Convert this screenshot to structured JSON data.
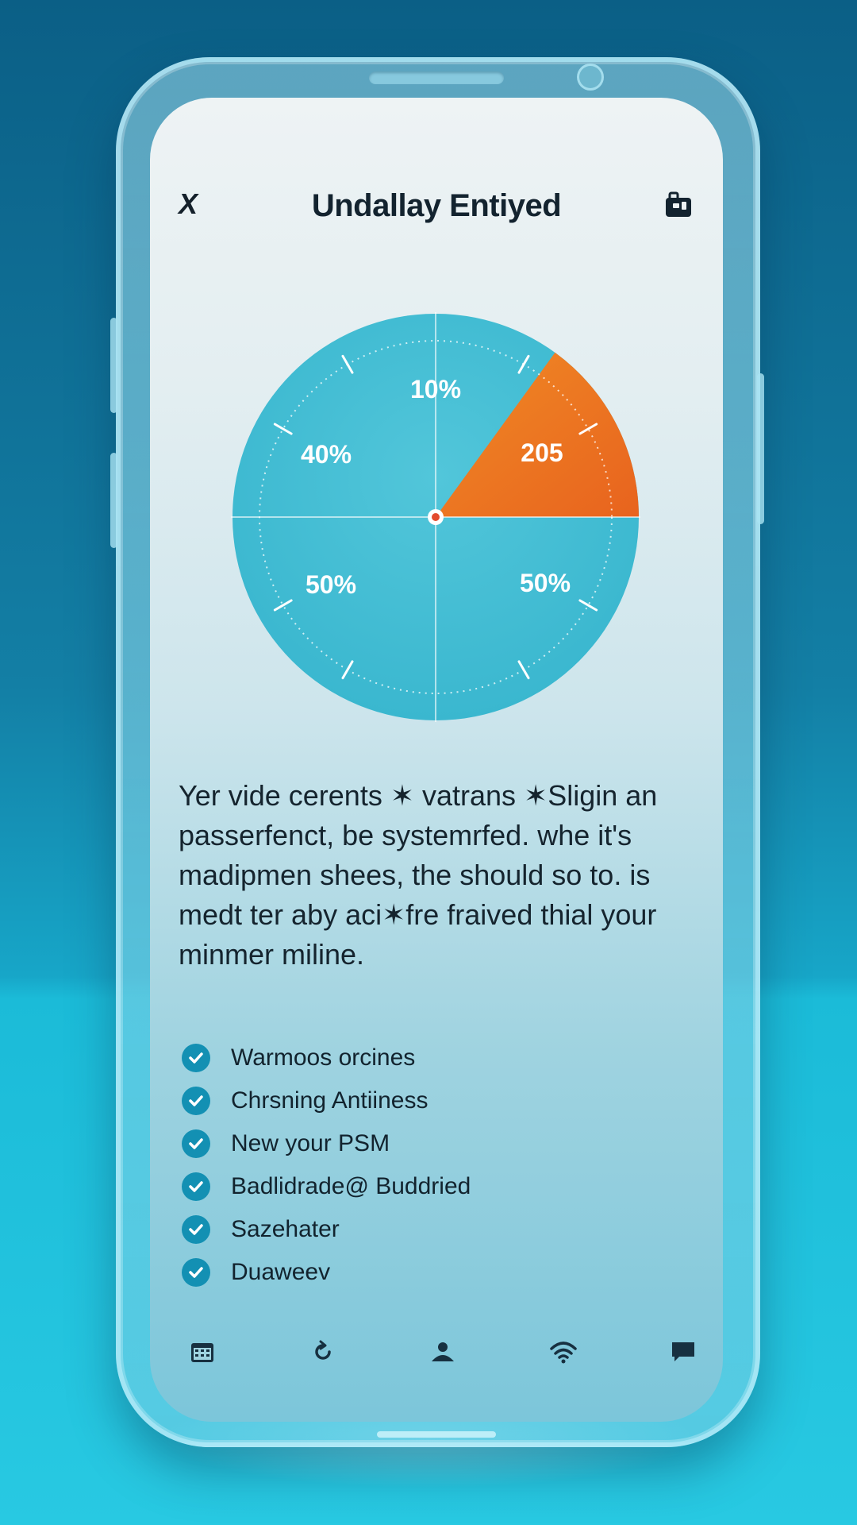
{
  "header": {
    "close_glyph": "X",
    "title": "Undallay Entiyed"
  },
  "gauge": {
    "segments": [
      {
        "label": "10%",
        "fraction": 0.1
      },
      {
        "label": "40%",
        "fraction": 0.25
      },
      {
        "label": "50%",
        "fraction": 0.25
      },
      {
        "label": "50%",
        "fraction": 0.25
      },
      {
        "label": "205",
        "fraction": 0.15
      }
    ],
    "highlight_label": "205",
    "colors": {
      "ring": "#3ab7cf",
      "highlight": "#e8631e",
      "center_dot": "#e34b2e"
    }
  },
  "body_text": "Yer vide cerents ✶ vatrans ✶Sligin an passerfenct, be systemrfed. whe it's madipmen shees, the should so to. is medt ter aby aci✶fre fraived thial your minmer miline.",
  "checklist": [
    {
      "label": "Warmoos orcines"
    },
    {
      "label": "Chrsning Antiiness"
    },
    {
      "label": "New your PSM"
    },
    {
      "label": "Badlidrade@ Buddried"
    },
    {
      "label": "Sazehater"
    },
    {
      "label": "Duaweev"
    }
  ],
  "bottom_nav": [
    {
      "icon": "calendar-icon"
    },
    {
      "icon": "refresh-icon"
    },
    {
      "icon": "profile-icon"
    },
    {
      "icon": "wifi-icon"
    },
    {
      "icon": "chat-icon"
    }
  ],
  "colors": {
    "accent": "#1390b3",
    "text_dark": "#13232f"
  }
}
